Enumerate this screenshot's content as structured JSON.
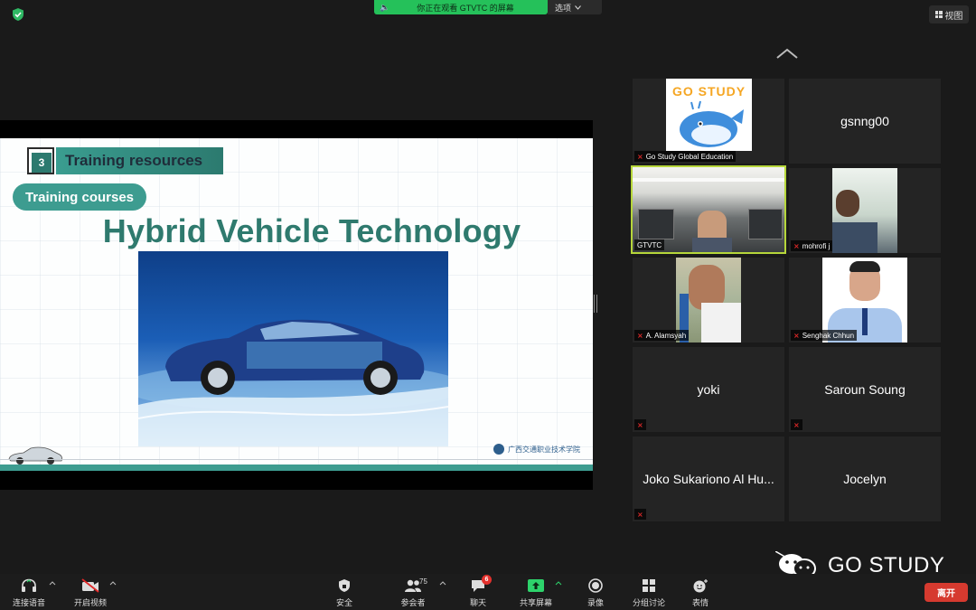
{
  "top": {
    "share_banner": "你正在观看 GTVTC 的屏幕",
    "options_label": "选项",
    "view_label": "视图"
  },
  "slide": {
    "section_number": "3",
    "section_title": "Training resources",
    "pill_label": "Training courses",
    "main_title": "Hybrid Vehicle Technology",
    "school_logo": "广西交通职业技术学院"
  },
  "gallery": {
    "tiles": [
      {
        "name": "Go Study Global Education",
        "center": "",
        "avatar": "go-study-logo"
      },
      {
        "name": "",
        "center": "gsnng00",
        "avatar": ""
      },
      {
        "name": "GTVTC",
        "center": "",
        "avatar": "video"
      },
      {
        "name": "mohrofi j",
        "center": "",
        "avatar": "video"
      },
      {
        "name": "A. Alamsyah",
        "center": "",
        "avatar": "video"
      },
      {
        "name": "Senghak Chhun",
        "center": "",
        "avatar": "photo"
      },
      {
        "name": "",
        "center": "yoki",
        "avatar": ""
      },
      {
        "name": "",
        "center": "Saroun Soung",
        "avatar": ""
      },
      {
        "name": "",
        "center": "Joko Sukariono Al Hu...",
        "avatar": ""
      },
      {
        "name": "",
        "center": "Jocelyn",
        "avatar": ""
      }
    ],
    "go_study_logo_text": "GO STUDY"
  },
  "watermark": {
    "text": "GO STUDY"
  },
  "toolbar": {
    "audio_label": "连接语音",
    "video_label": "开启视频",
    "security_label": "安全",
    "participants_label": "参会者",
    "participants_count": "75",
    "chat_label": "聊天",
    "chat_badge": "6",
    "share_label": "共享屏幕",
    "record_label": "录像",
    "breakout_label": "分组讨论",
    "reactions_label": "表情",
    "leave_label": "离开"
  },
  "colors": {
    "share_green": "#25c15a",
    "slide_teal": "#2f7a6e",
    "active_border": "#b6d63a",
    "leave_red": "#d63a2f",
    "mic_off_red": "#e02828"
  }
}
